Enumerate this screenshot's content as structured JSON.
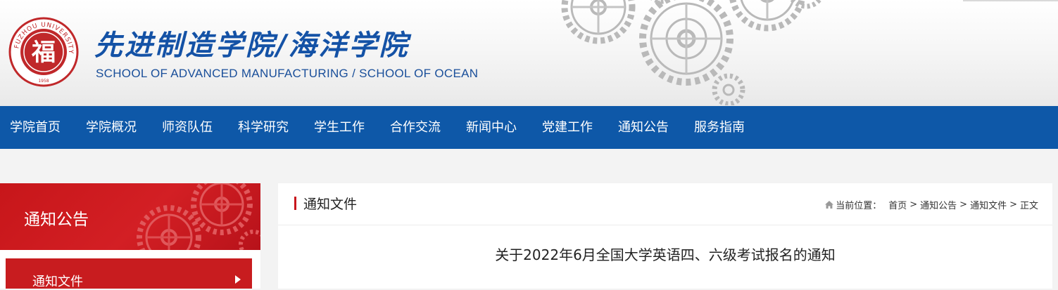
{
  "header": {
    "title_cn": "先进制造学院/海洋学院",
    "title_en": "SCHOOL OF ADVANCED MANUFACTURING / SCHOOL OF OCEAN",
    "seal_text": "FUZHOU UNIVERSITY",
    "seal_char": "福",
    "seal_year": "1958",
    "brand_color": "#1452a6"
  },
  "nav": {
    "items": [
      "学院首页",
      "学院概况",
      "师资队伍",
      "科学研究",
      "学生工作",
      "合作交流",
      "新闻中心",
      "党建工作",
      "通知公告",
      "服务指南"
    ],
    "bg_color": "#0e58a8"
  },
  "sidebar": {
    "title": "通知公告",
    "items": [
      {
        "label": "通知文件",
        "icon": "triangle-right-icon"
      }
    ],
    "accent_color": "#c8161d"
  },
  "main": {
    "heading": "通知文件",
    "breadcrumb": {
      "label": "当前位置：",
      "icon": "home-icon",
      "items": [
        "首页",
        "通知公告",
        "通知文件",
        "正文"
      ],
      "separator": ">"
    },
    "article_title": "关于2022年6月全国大学英语四、六级考试报名的通知"
  }
}
